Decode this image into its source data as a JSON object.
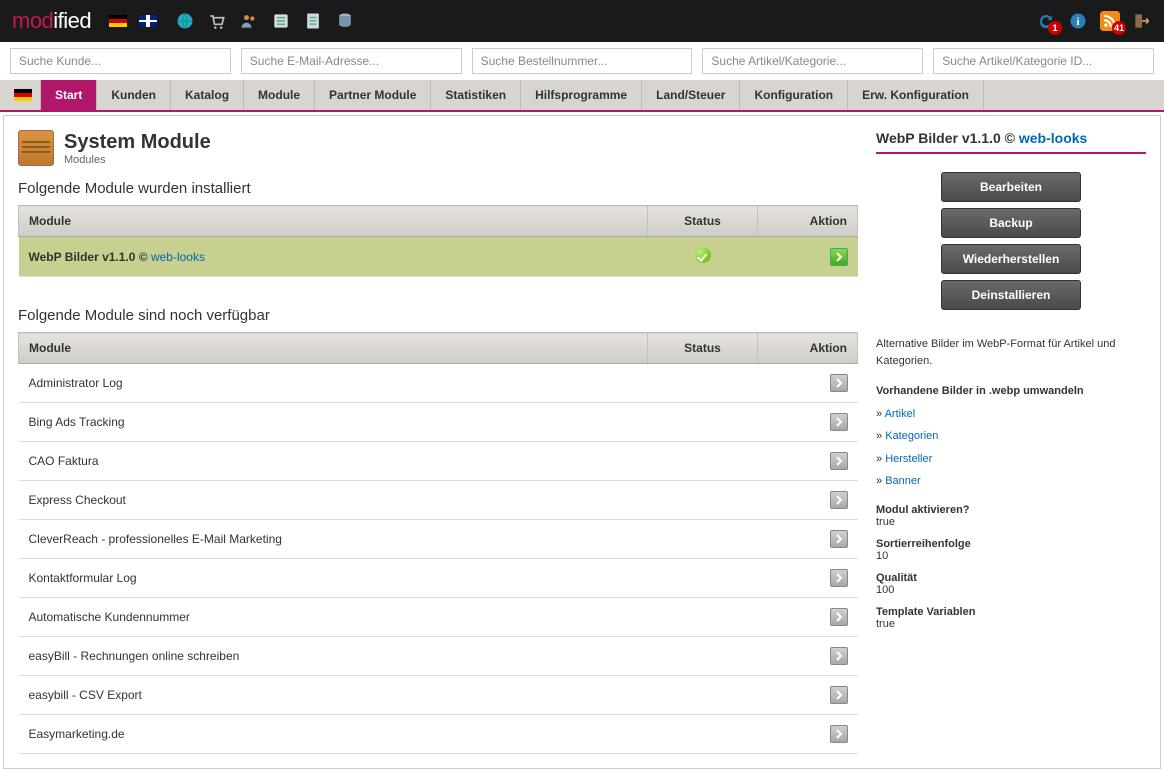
{
  "brand": {
    "left": "mod",
    "right": "ified"
  },
  "topbar": {
    "badges": {
      "refresh": "1",
      "rss": "41"
    }
  },
  "search": {
    "customer": "Suche Kunde...",
    "email": "Suche E-Mail-Adresse...",
    "order": "Suche Bestellnummer...",
    "article": "Suche Artikel/Kategorie...",
    "article_id": "Suche Artikel/Kategorie ID..."
  },
  "nav": {
    "items": [
      "Start",
      "Kunden",
      "Katalog",
      "Module",
      "Partner Module",
      "Statistiken",
      "Hilfsprogramme",
      "Land/Steuer",
      "Konfiguration",
      "Erw. Konfiguration"
    ],
    "active": 0
  },
  "page": {
    "title": "System Module",
    "subtitle": "Modules",
    "installed_heading": "Folgende Module wurden installiert",
    "available_heading": "Folgende Module sind noch verfügbar",
    "cols": {
      "module": "Module",
      "status": "Status",
      "action": "Aktion"
    }
  },
  "installed": [
    {
      "name": "WebP Bilder v1.1.0 © ",
      "link": "web-looks",
      "status": "ok",
      "selected": true
    }
  ],
  "available": [
    {
      "name": "Administrator Log"
    },
    {
      "name": "Bing Ads Tracking"
    },
    {
      "name": "CAO Faktura"
    },
    {
      "name": "Express Checkout"
    },
    {
      "name": "CleverReach - professionelles E-Mail Marketing"
    },
    {
      "name": "Kontaktformular Log"
    },
    {
      "name": "Automatische Kundennummer"
    },
    {
      "name": "easyBill - Rechnungen online schreiben"
    },
    {
      "name": "easybill - CSV Export"
    },
    {
      "name": "Easymarketing.de"
    }
  ],
  "sidebar": {
    "title_pre": "WebP Bilder v1.1.0 © ",
    "title_link": "web-looks",
    "buttons": {
      "edit": "Bearbeiten",
      "backup": "Backup",
      "restore": "Wiederherstellen",
      "uninstall": "Deinstallieren"
    },
    "desc": "Alternative Bilder im WebP-Format für Artikel und Kategorien.",
    "convert_heading": "Vorhandene Bilder in .webp umwandeln",
    "links": [
      "Artikel",
      "Kategorien",
      "Hersteller",
      "Banner"
    ],
    "config": [
      {
        "k": "Modul aktivieren?",
        "v": "true"
      },
      {
        "k": "Sortierreihenfolge",
        "v": "10"
      },
      {
        "k": "Qualität",
        "v": "100"
      },
      {
        "k": "Template Variablen",
        "v": "true"
      }
    ]
  }
}
